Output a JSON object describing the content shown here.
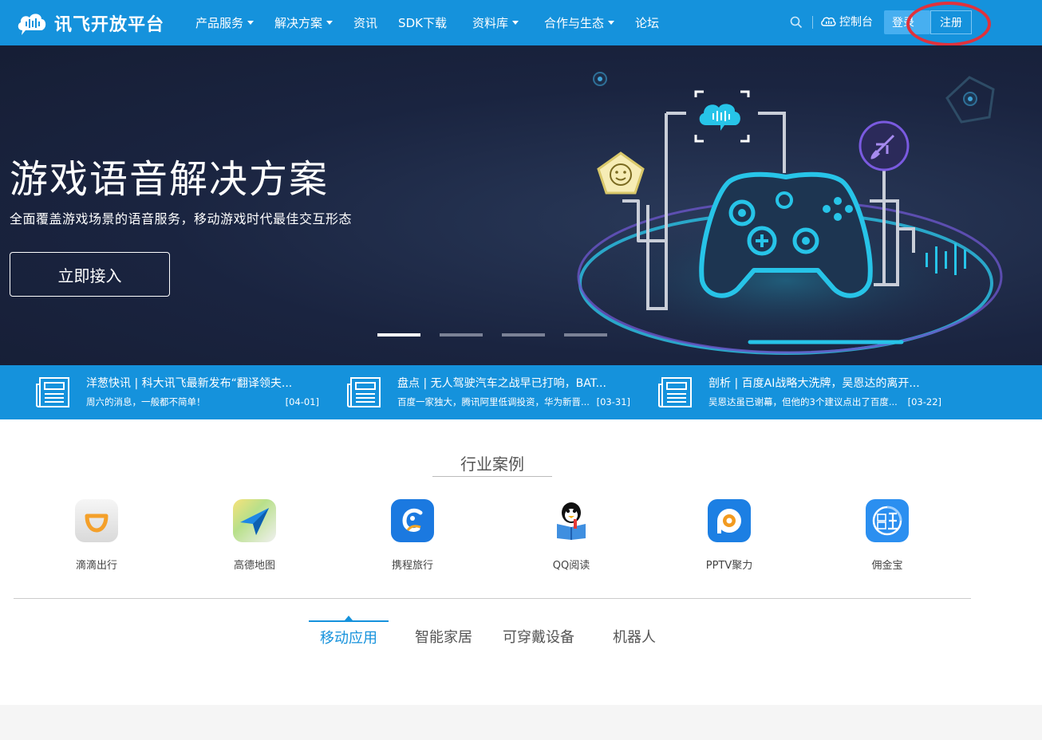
{
  "header": {
    "brand": "讯飞开放平台",
    "nav": [
      {
        "label": "产品服务",
        "dropdown": true
      },
      {
        "label": "解决方案",
        "dropdown": true
      },
      {
        "label": "资讯",
        "dropdown": false
      },
      {
        "label": "SDK下载",
        "dropdown": false
      },
      {
        "label": "资料库",
        "dropdown": true
      },
      {
        "label": "合作与生态",
        "dropdown": true
      },
      {
        "label": "论坛",
        "dropdown": false
      }
    ],
    "console_label": "控制台",
    "login_label": "登录",
    "register_label": "注册"
  },
  "hero": {
    "title": "游戏语音解决方案",
    "subtitle": "全面覆盖游戏场景的语音服务，移动游戏时代最佳交互形态",
    "cta_label": "立即接入",
    "active_slide": 1,
    "slide_count": 4
  },
  "news": [
    {
      "title": "洋葱快讯 | 科大讯飞最新发布“翻译领夫...",
      "desc": "周六的消息，一般都不简单！",
      "date": "[04-01]"
    },
    {
      "title": "盘点 | 无人驾驶汽车之战早已打响，BAT...",
      "desc": "百度一家独大，腾讯阿里低调投资，华为新晋...",
      "date": "[03-31]"
    },
    {
      "title": "剖析 | 百度AI战略大洗牌，吴恩达的离开...",
      "desc": "吴恩达虽已谢幕，但他的3个建议点出了百度...",
      "date": "[03-22]"
    }
  ],
  "cases": {
    "title": "行业案例",
    "apps": [
      {
        "label": "滴滴出行",
        "icon": "didi-icon"
      },
      {
        "label": "高德地图",
        "icon": "amap-icon"
      },
      {
        "label": "携程旅行",
        "icon": "ctrip-icon"
      },
      {
        "label": "QQ阅读",
        "icon": "qq-reader-icon"
      },
      {
        "label": "PPTV聚力",
        "icon": "pptv-icon"
      },
      {
        "label": "佣金宝",
        "icon": "yongjinbao-icon"
      }
    ],
    "tabs": [
      "移动应用",
      "智能家居",
      "可穿戴设备",
      "机器人"
    ],
    "active_tab": 0
  },
  "colors": {
    "brand_blue": "#1592dc",
    "hero_bg": "#1a2440",
    "accent_cyan": "#27c4e8",
    "annotation_red": "#e0323c"
  }
}
